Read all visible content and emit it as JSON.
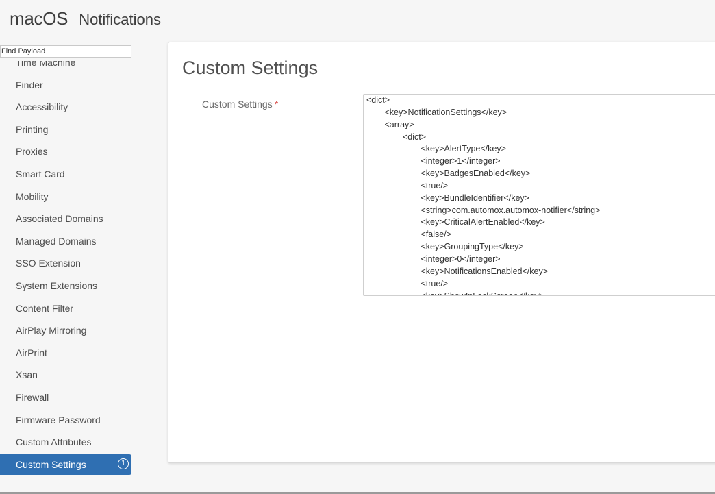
{
  "header": {
    "os": "macOS",
    "title": "Notifications"
  },
  "search": {
    "placeholder": "Find Payload"
  },
  "sidebar": {
    "items": [
      {
        "label": "Time Machine"
      },
      {
        "label": "Finder"
      },
      {
        "label": "Accessibility"
      },
      {
        "label": "Printing"
      },
      {
        "label": "Proxies"
      },
      {
        "label": "Smart Card"
      },
      {
        "label": "Mobility"
      },
      {
        "label": "Associated Domains"
      },
      {
        "label": "Managed Domains"
      },
      {
        "label": "SSO Extension"
      },
      {
        "label": "System Extensions"
      },
      {
        "label": "Content Filter"
      },
      {
        "label": "AirPlay Mirroring"
      },
      {
        "label": "AirPrint"
      },
      {
        "label": "Xsan"
      },
      {
        "label": "Firewall"
      },
      {
        "label": "Firmware Password"
      },
      {
        "label": "Custom Attributes"
      }
    ],
    "active": {
      "label": "Custom Settings",
      "badge": "1"
    }
  },
  "panel": {
    "title": "Custom Settings",
    "field_label": "Custom Settings",
    "required_mark": "*",
    "code_lines": [
      {
        "indent": 0,
        "text": "<dict>"
      },
      {
        "indent": 1,
        "text": "<key>NotificationSettings</key>"
      },
      {
        "indent": 1,
        "text": "<array>"
      },
      {
        "indent": 2,
        "text": "<dict>"
      },
      {
        "indent": 3,
        "text": "<key>AlertType</key>"
      },
      {
        "indent": 3,
        "text": "<integer>1</integer>"
      },
      {
        "indent": 3,
        "text": "<key>BadgesEnabled</key>"
      },
      {
        "indent": 3,
        "text": "<true/>"
      },
      {
        "indent": 3,
        "text": "<key>BundleIdentifier</key>"
      },
      {
        "indent": 3,
        "text": "<string>com.automox.automox-notifier</string>"
      },
      {
        "indent": 3,
        "text": "<key>CriticalAlertEnabled</key>"
      },
      {
        "indent": 3,
        "text": "<false/>"
      },
      {
        "indent": 3,
        "text": "<key>GroupingType</key>"
      },
      {
        "indent": 3,
        "text": "<integer>0</integer>"
      },
      {
        "indent": 3,
        "text": "<key>NotificationsEnabled</key>"
      },
      {
        "indent": 3,
        "text": "<true/>"
      },
      {
        "indent": 3,
        "text": "<key>ShowInLockScreen</key>"
      }
    ]
  },
  "colors": {
    "accent": "#2f6fb2",
    "required": "#d9534f"
  }
}
